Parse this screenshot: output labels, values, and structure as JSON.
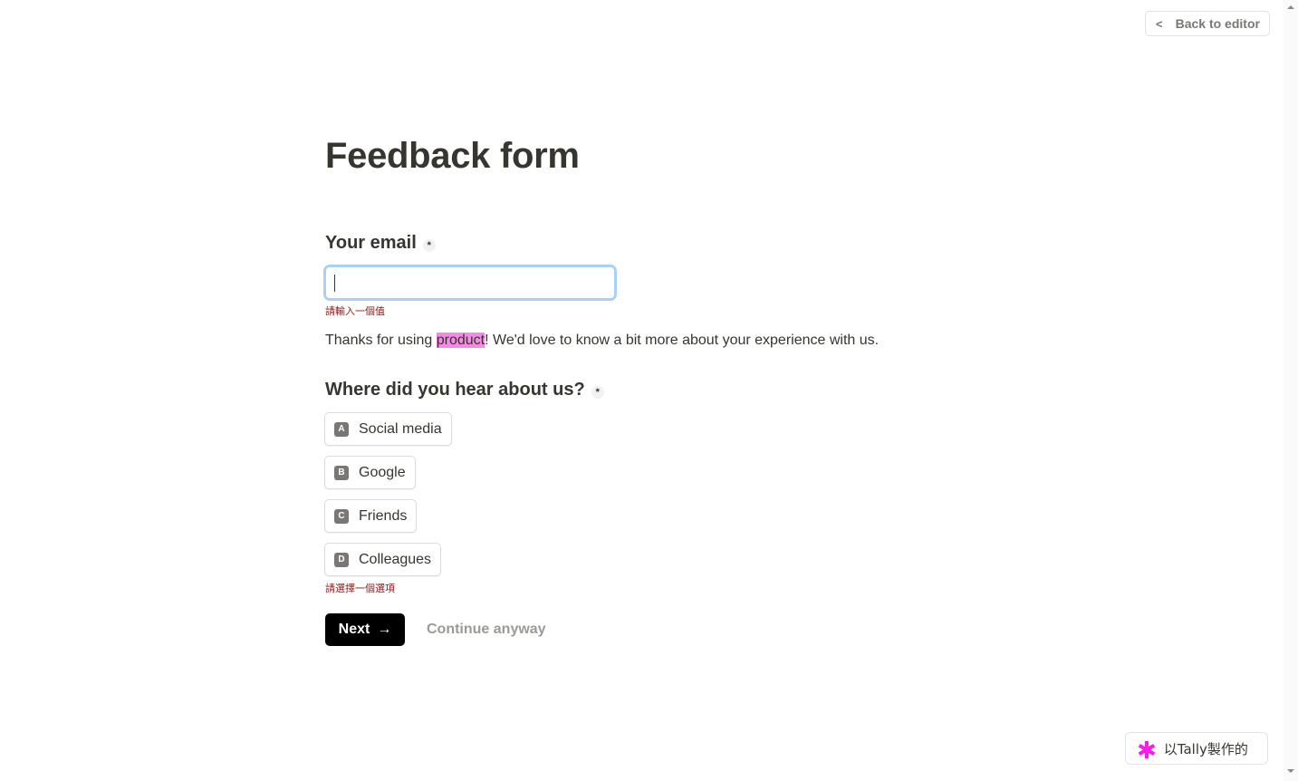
{
  "header": {
    "back_button_label": "Back to editor",
    "back_icon": "chevron-left-icon"
  },
  "form": {
    "title": "Feedback form",
    "email_question": {
      "label": "Your email",
      "required_mark": "*",
      "value": "",
      "placeholder": "",
      "error": "請輸入一個值"
    },
    "description": {
      "before": "Thanks for using ",
      "highlight": "product",
      "after": "! We'd love to know a bit more about your experience with us.",
      "highlight_color": "#f48ae6"
    },
    "source_question": {
      "label": "Where did you hear about us?",
      "required_mark": "*",
      "options": [
        {
          "key": "A",
          "label": "Social media"
        },
        {
          "key": "B",
          "label": "Google"
        },
        {
          "key": "C",
          "label": "Friends"
        },
        {
          "key": "D",
          "label": "Colleagues"
        }
      ],
      "error": "請選擇一個選項"
    },
    "next_button_label": "Next",
    "next_icon": "arrow-right-icon",
    "continue_label": "Continue anyway"
  },
  "footer": {
    "badge_label": "以Tally製作的",
    "badge_icon": "tally-asterisk-icon",
    "brand_color": "#f81ce5"
  },
  "colors": {
    "input_focus_border": "#a9d1f7",
    "error_text": "#8b1a1a",
    "primary_button": "#000000"
  }
}
